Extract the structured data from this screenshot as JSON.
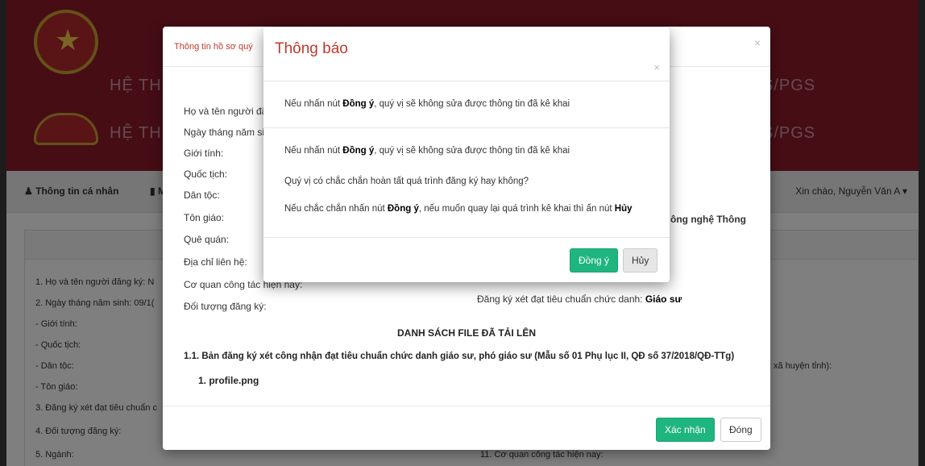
{
  "background": {
    "header_title": "HỆ TH",
    "header_title_right": "S/PGS",
    "nav": {
      "profile": "Thông tin cá nhân",
      "second": "M",
      "greeting": "Xin chào, Nguyễn Văn A ▾"
    },
    "list_left": [
      "1. Họ và tên người đăng ký: N",
      "2. Ngày tháng năm sinh: 09/1(",
      "- Giới tính:",
      "- Quốc tịch:",
      "- Dân tộc:",
      "- Tôn giáo:",
      "3. Đăng ký xét đạt tiêu chuẩn c",
      "4. Đối tượng đăng ký:",
      "5. Ngành:"
    ],
    "list_right": {
      "province": "xã huyện tỉnh):",
      "agency": "11. Cơ quan công tác hiện nay:"
    }
  },
  "modal": {
    "title": "Thông tin hồ sơ quý",
    "close": "×",
    "labels": [
      "Họ và tên người đă",
      "Ngày tháng năm sir",
      "Giới tính:",
      "Quốc tịch:",
      "Dân tộc:",
      "Tôn giáo:",
      "Quê quán:",
      "Địa chỉ liên hệ:",
      "Cơ quan công tác hiện nay:",
      "Đối tượng đăng ký:"
    ],
    "right_fragment": "ông nghệ Thông",
    "register_label": "Đăng ký xét đạt tiêu chuẩn chức danh: ",
    "register_value": "Giáo sư",
    "file_list_heading": "DANH SÁCH FILE ĐÃ TẢI LÊN",
    "file_doc_title": "1.1. Bản đăng ký xét công nhận đạt tiêu chuẩn chức danh giáo sư, phó giáo sư (Mẫu số 01 Phụ lục II, QĐ số 37/2018/QĐ-TTg)",
    "file_item": "1. profile.png",
    "confirm_button": "Xác nhận",
    "close_button": "Đóng"
  },
  "notice": {
    "title": "Thông báo",
    "close": "×",
    "line1_pre": "Nếu nhấn nút ",
    "line1_bold": "Đồng ý",
    "line1_post": ", quý vị sẽ không sửa được thông tin đã kê khai",
    "line2_pre": "Nếu nhấn nút ",
    "line2_bold": "Đồng ý",
    "line2_post": ", quý vị sẽ không sửa được thông tin đã kê khai",
    "line3": "Quý vị có chắc chắn hoàn tất quá trình đăng ký hay không?",
    "line4_pre": "Nếu chắc chắn nhấn nút ",
    "line4_bold": "Đồng ý",
    "line4_mid": ", nếu muốn quay lại quá trình kê khai thì ấn nút ",
    "line4_bold2": "Hủy",
    "agree_button": "Đồng ý",
    "cancel_button": "Hủy"
  }
}
